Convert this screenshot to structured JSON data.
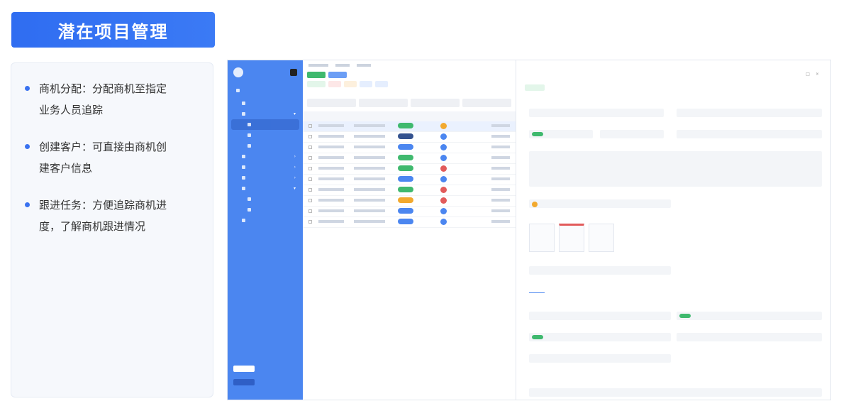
{
  "banner": {
    "title": "潜在项目管理"
  },
  "features": [
    {
      "line1": "商机分配：分配商机至指定",
      "line2": "业务人员追踪"
    },
    {
      "line1": "创建客户：可直接由商机创",
      "line2": "建客户信息"
    },
    {
      "line1": "跟进任务：方便追踪商机进",
      "line2": "度，了解商机跟进情况"
    }
  ],
  "colors": {
    "accent": "#2f6df1",
    "sidebar": "#4b86f0",
    "green": "#3fb96e",
    "red": "#e25b5b",
    "orange": "#f2a92e"
  },
  "table_rows": [
    {
      "pill": "pgreen",
      "dot": "porange",
      "selected": true
    },
    {
      "pill": "pnavy",
      "dot": "pblue",
      "selected": false
    },
    {
      "pill": "pblue",
      "dot": "pblue",
      "selected": false
    },
    {
      "pill": "pgreen",
      "dot": "pblue",
      "selected": false
    },
    {
      "pill": "pgreen",
      "dot": "pred",
      "selected": false
    },
    {
      "pill": "pblue",
      "dot": "pblue",
      "selected": false
    },
    {
      "pill": "pgreen",
      "dot": "pred",
      "selected": false
    },
    {
      "pill": "porange",
      "dot": "pred",
      "selected": false
    },
    {
      "pill": "pblue",
      "dot": "pblue",
      "selected": false
    },
    {
      "pill": "pblue",
      "dot": "pblue",
      "selected": false
    }
  ]
}
